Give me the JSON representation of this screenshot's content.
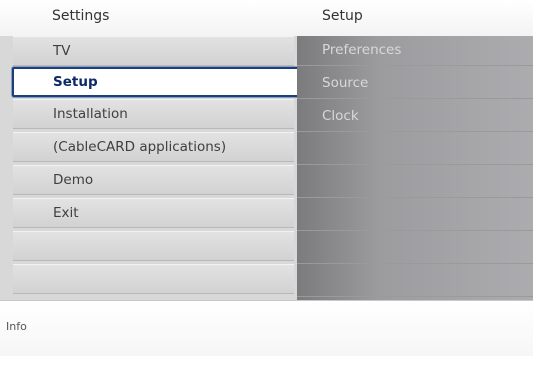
{
  "header": {
    "left_title": "Settings",
    "right_title": "Setup"
  },
  "left_menu": {
    "items": [
      {
        "label": "TV",
        "selected": false
      },
      {
        "label": "Setup",
        "selected": true
      },
      {
        "label": "Installation",
        "selected": false
      },
      {
        "label": "(CableCARD applications)",
        "selected": false
      },
      {
        "label": "Demo",
        "selected": false
      },
      {
        "label": "Exit",
        "selected": false
      },
      {
        "label": "",
        "selected": false
      },
      {
        "label": "",
        "selected": false
      }
    ]
  },
  "right_menu": {
    "items": [
      {
        "label": "Preferences"
      },
      {
        "label": "Source"
      },
      {
        "label": "Clock"
      },
      {
        "label": ""
      },
      {
        "label": ""
      },
      {
        "label": ""
      },
      {
        "label": ""
      },
      {
        "label": ""
      }
    ]
  },
  "info": {
    "label": "Info"
  },
  "colors": {
    "selection_border": "#1c3f7a",
    "left_panel_bg": "#d8d8d8",
    "right_panel_bg": "#9c9c9f"
  }
}
